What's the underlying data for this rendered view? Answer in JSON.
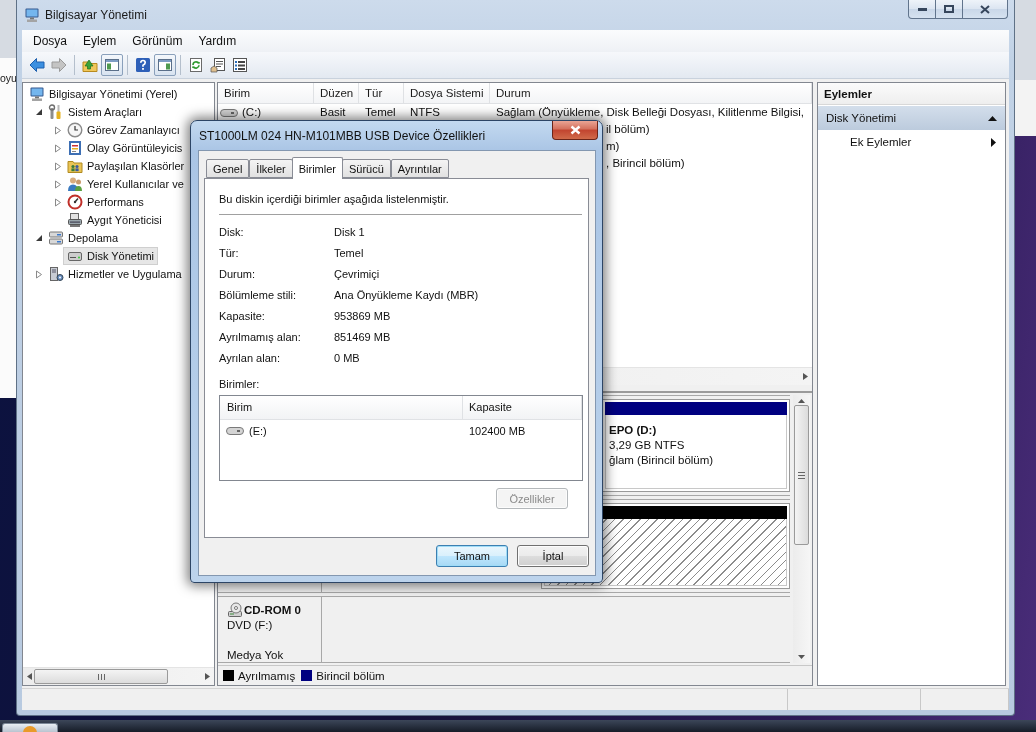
{
  "desktop": {
    "background_window": {
      "text": "oyu"
    }
  },
  "window": {
    "title": "Bilgisayar Yönetimi"
  },
  "menu": [
    {
      "label": "Dosya"
    },
    {
      "label": "Eylem"
    },
    {
      "label": "Görünüm"
    },
    {
      "label": "Yardım"
    }
  ],
  "toolbar": [
    [
      {
        "kind": "back",
        "disabled": false,
        "on": false
      },
      {
        "kind": "forward",
        "disabled": true,
        "on": false
      }
    ],
    [
      {
        "kind": "up",
        "disabled": false,
        "on": false
      },
      {
        "kind": "console-tree",
        "disabled": false,
        "on": true
      }
    ],
    [
      {
        "kind": "help",
        "disabled": false,
        "on": false
      },
      {
        "kind": "action-pane",
        "disabled": false,
        "on": true
      }
    ],
    [
      {
        "kind": "refresh",
        "disabled": false,
        "on": false
      },
      {
        "kind": "properties",
        "disabled": false,
        "on": false
      },
      {
        "kind": "export",
        "disabled": false,
        "on": false
      }
    ]
  ],
  "tree": [
    {
      "label": "Bilgisayar Yönetimi (Yerel)",
      "kind": "computer",
      "expandable": false,
      "selected": false,
      "children": [
        {
          "label": "Sistem Araçları",
          "kind": "tools",
          "expandable": true,
          "expanded": true,
          "selected": false,
          "children": [
            {
              "label": "Görev Zamanlayıcı",
              "kind": "clock",
              "expandable": true,
              "expanded": false,
              "selected": false
            },
            {
              "label": "Olay Görüntüleyicis",
              "kind": "event-log",
              "expandable": true,
              "expanded": false,
              "selected": false
            },
            {
              "label": "Paylaşılan Klasörler",
              "kind": "shared-folder",
              "expandable": true,
              "expanded": false,
              "selected": false
            },
            {
              "label": "Yerel Kullanıcılar ve",
              "kind": "users",
              "expandable": true,
              "expanded": false,
              "selected": false
            },
            {
              "label": "Performans",
              "kind": "performance",
              "expandable": true,
              "expanded": false,
              "selected": false
            },
            {
              "label": "Aygıt Yöneticisi",
              "kind": "device-manager",
              "expandable": false,
              "selected": false
            }
          ]
        },
        {
          "label": "Depolama",
          "kind": "storage",
          "expandable": true,
          "expanded": true,
          "selected": false,
          "children": [
            {
              "label": "Disk Yönetimi",
              "kind": "disk",
              "expandable": false,
              "selected": true
            }
          ]
        },
        {
          "label": "Hizmetler ve Uygulama",
          "kind": "services",
          "expandable": true,
          "expanded": false,
          "selected": false
        }
      ]
    }
  ],
  "volumes_table": {
    "columns": [
      {
        "label": "Birim"
      },
      {
        "label": "Düzen"
      },
      {
        "label": "Tür"
      },
      {
        "label": "Dosya Sistemi"
      },
      {
        "label": "Durum"
      }
    ],
    "rows": [
      {
        "volume": "(C:)",
        "layout": "Basit",
        "type": "Temel",
        "file_system": "NTFS",
        "status": "Sağlam (Önyükleme, Disk Belleği Dosyası, Kilitlenme Bilgisi,"
      },
      {
        "status": "il bölüm)"
      },
      {
        "status": "m)"
      },
      {
        "status": ", Birincil bölüm)"
      }
    ]
  },
  "disk_map": {
    "disks": [
      {
        "kind": "disk",
        "partitions": [
          {
            "kind": "primary",
            "name": "EPO (D:)",
            "size": "3,29 GB NTFS",
            "status": "ğlam (Birincil bölüm)"
          }
        ]
      },
      {
        "kind": "disk",
        "partitions": [
          {
            "kind": "unallocated"
          }
        ]
      },
      {
        "kind": "cdrom",
        "title": "CD-ROM 0",
        "drive": "DVD (F:)",
        "media": "Medya Yok"
      }
    ],
    "legend": [
      {
        "label": "Ayrılmamış",
        "color": "#000000"
      },
      {
        "label": "Birincil bölüm",
        "color": "#000080"
      }
    ]
  },
  "actions": {
    "title": "Eylemler",
    "sections": [
      {
        "label": "Disk Yönetimi",
        "expanded": true,
        "items": [
          {
            "label": "Ek Eylemler",
            "submenu": true
          }
        ]
      }
    ]
  },
  "dialog": {
    "title": "ST1000LM 024 HN-M101MBB USB Device Özellikleri",
    "tabs": [
      {
        "label": "Genel",
        "selected": false
      },
      {
        "label": "İlkeler",
        "selected": false
      },
      {
        "label": "Birimler",
        "selected": true
      },
      {
        "label": "Sürücü",
        "selected": false
      },
      {
        "label": "Ayrıntılar",
        "selected": false
      }
    ],
    "intro": "Bu diskin içerdiği birimler aşağıda listelenmiştir.",
    "properties": [
      {
        "label": "Disk:",
        "value": "Disk 1"
      },
      {
        "label": "Tür:",
        "value": "Temel"
      },
      {
        "label": "Durum:",
        "value": "Çevrimiçi"
      },
      {
        "label": "Bölümleme stili:",
        "value": "Ana Önyükleme Kaydı (MBR)"
      },
      {
        "label": "Kapasite:",
        "value": "953869 MB"
      },
      {
        "label": "Ayrılmamış alan:",
        "value": "851469 MB"
      },
      {
        "label": "Ayrılan alan:",
        "value": "0 MB"
      }
    ],
    "volumes_label": "Birimler:",
    "volumes": {
      "columns": [
        {
          "label": "Birim"
        },
        {
          "label": "Kapasite"
        }
      ],
      "rows": [
        {
          "volume": "(E:)",
          "capacity": "102400 MB"
        }
      ]
    },
    "properties_button": {
      "label": "Özellikler",
      "disabled": true
    },
    "buttons": [
      {
        "label": "Tamam",
        "default": true
      },
      {
        "label": "İptal",
        "default": false
      }
    ]
  }
}
